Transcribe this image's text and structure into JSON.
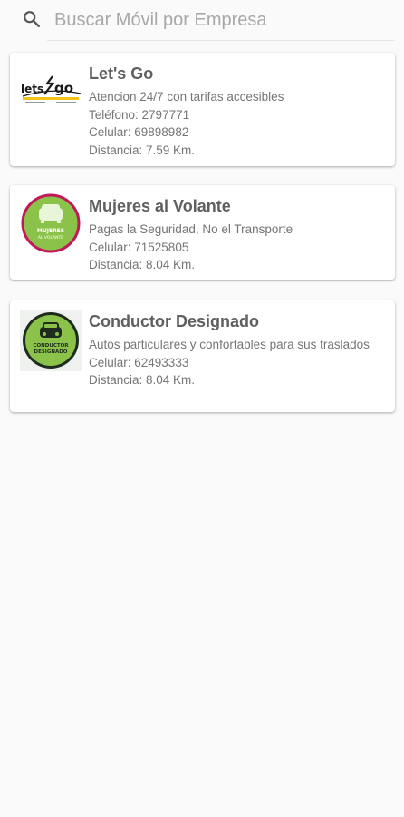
{
  "search": {
    "placeholder": "Buscar Móvil por Empresa",
    "value": ""
  },
  "companies": [
    {
      "logo_icon": "lets-go-logo-icon",
      "name": "Let's Go",
      "tagline": "Atencion 24/7 con tarifas accesibles",
      "phone": "Teléfono: 2797771",
      "cell": "Celular: 69898982",
      "distance": "Distancia: 7.59 Km."
    },
    {
      "logo_icon": "mujeres-al-volante-logo-icon",
      "name": "Mujeres al Volante",
      "tagline": "Pagas la Seguridad, No el Transporte",
      "cell": "Celular: 71525805",
      "distance": "Distancia: 8.04 Km."
    },
    {
      "logo_icon": "conductor-designado-logo-icon",
      "name": "Conductor Designado",
      "tagline": "Autos particulares y confortables para sus traslados",
      "cell": "Celular: 62493333",
      "distance": "Distancia: 8.04 Km."
    }
  ],
  "colors": {
    "background": "#fafafa",
    "card": "#ffffff",
    "title": "#5f5f5f",
    "text": "#757575",
    "placeholder": "#a8a8a8",
    "accent_yellow": "#f2c31b",
    "accent_pink": "#c2185b",
    "accent_green": "#8bc34a"
  }
}
